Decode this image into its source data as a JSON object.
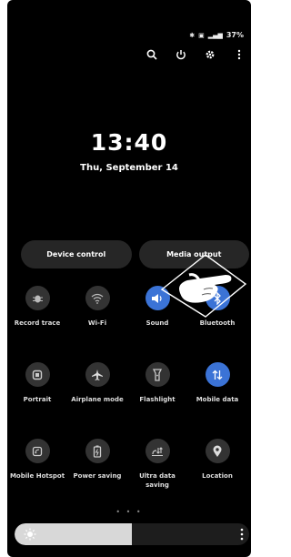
{
  "status": {
    "battery": "37%",
    "icons": [
      "bluetooth-icon",
      "mute-icon",
      "signal-icon"
    ]
  },
  "top_actions": [
    "search-icon",
    "power-icon",
    "settings-icon",
    "more-vertical-icon"
  ],
  "clock": {
    "time": "13:40",
    "date": "Thu, September 14"
  },
  "buttons": {
    "device_control": "Device control",
    "media_output": "Media output"
  },
  "tiles": [
    [
      {
        "label": "Record trace",
        "icon": "bug-icon",
        "on": false
      },
      {
        "label": "Wi-Fi",
        "icon": "wifi-icon",
        "on": false
      },
      {
        "label": "Sound",
        "icon": "speaker-icon",
        "on": true
      },
      {
        "label": "Bluetooth",
        "icon": "bluetooth-icon",
        "on": true
      }
    ],
    [
      {
        "label": "Portrait",
        "icon": "portrait-icon",
        "on": false
      },
      {
        "label": "Airplane mode",
        "icon": "airplane-icon",
        "on": false
      },
      {
        "label": "Flashlight",
        "icon": "flashlight-icon",
        "on": false
      },
      {
        "label": "Mobile data",
        "icon": "mobile-data-icon",
        "on": true
      }
    ],
    [
      {
        "label": "Mobile Hotspot",
        "icon": "hotspot-icon",
        "on": false
      },
      {
        "label": "Power saving",
        "icon": "battery-saver-icon",
        "on": false
      },
      {
        "label": "Ultra data saving",
        "icon": "data-saver-icon",
        "on": false
      },
      {
        "label": "Location",
        "icon": "location-icon",
        "on": false
      }
    ]
  ],
  "page_indicator": "• • •",
  "brightness": {
    "level": 0.5
  },
  "colors": {
    "accent": "#3b73d6",
    "tile_off": "#333333",
    "background": "#000000"
  }
}
